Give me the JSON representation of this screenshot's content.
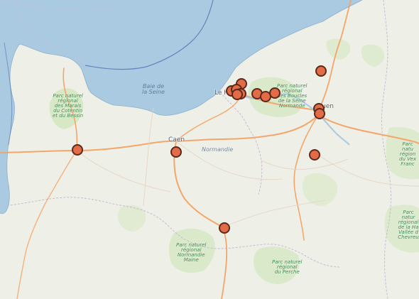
{
  "map": {
    "colors": {
      "sea": "#a9cae1",
      "land": "#eef0e8",
      "forest": "#cfe5b8",
      "road": "#f4a66a",
      "admin": "#c8b9d4",
      "marker": "#e36b45"
    },
    "labels": {
      "caen": "Caen",
      "le_havre": "Le H",
      "rouen": "uen",
      "normandie": "Normandie"
    },
    "sea_labels": {
      "baie_de_seine": "Baie de\nla Seine"
    },
    "park_labels": {
      "cotentin": "Parc naturel\nrégional\ndes Marais\ndu Cotentin\net du Bessin",
      "boucles_seine": "Parc naturel\nrégional\ndes Boucles\nde la Seine\nNormande",
      "normandie_maine": "Parc naturel\nrégional\nNormandie\nMaine",
      "perche": "Parc naturel\nrégional\ndu Perche",
      "vexin": "Parc natu\nrégion\ndu Vex\nFranc",
      "chevreuse": "Parc natur\nrégional\nde la Ha\nVallée d\nChevreu"
    }
  }
}
